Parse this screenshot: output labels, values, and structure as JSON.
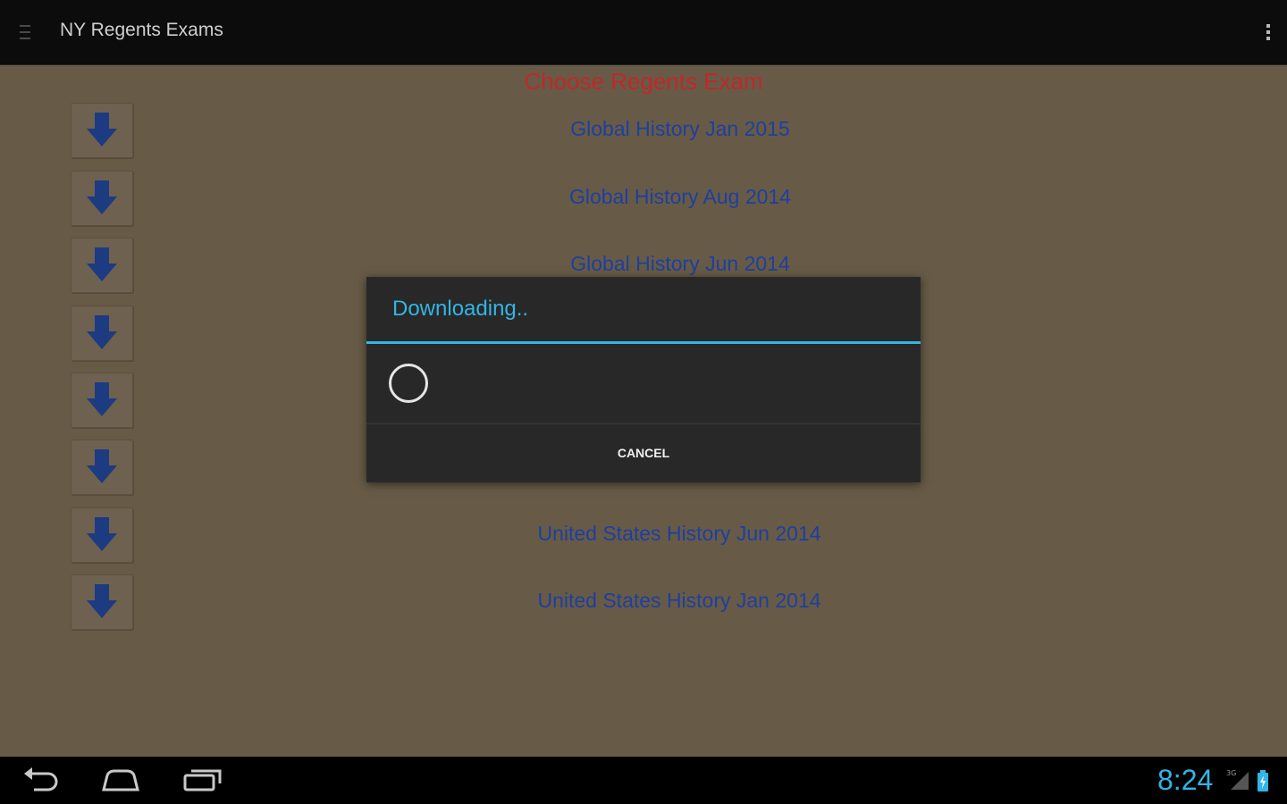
{
  "app": {
    "title": "NY Regents Exams"
  },
  "content": {
    "heading": "Choose Regents Exam",
    "exams": [
      {
        "label": "Global History Jan 2015"
      },
      {
        "label": "Global History Aug 2014"
      },
      {
        "label": "Global History Jun 2014"
      },
      {
        "label": ""
      },
      {
        "label": ""
      },
      {
        "label": ""
      },
      {
        "label": "United States History Jun 2014"
      },
      {
        "label": "United States History Jan 2014"
      }
    ]
  },
  "dialog": {
    "title": "Downloading..",
    "cancel_label": "CANCEL"
  },
  "statusbar": {
    "time": "8:24",
    "network": "3G"
  },
  "colors": {
    "background": "#675b47",
    "heading": "#c0282a",
    "link": "#1f3f9e",
    "accent": "#33b5e5"
  }
}
